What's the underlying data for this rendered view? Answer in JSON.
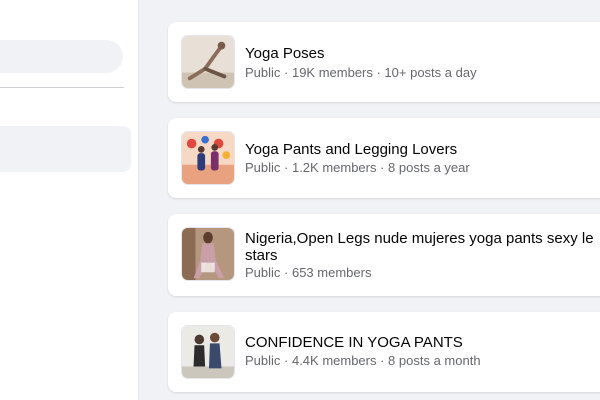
{
  "groups": [
    {
      "name": "Yoga Poses",
      "meta": "Public · 19K members · 10+ posts a day"
    },
    {
      "name": "Yoga Pants and Legging Lovers",
      "meta": "Public · 1.2K members · 8 posts a year"
    },
    {
      "name_line1": "Nigeria,Open Legs nude mujeres yoga pants sexy le",
      "name_line2": "stars",
      "meta": "Public · 653 members"
    },
    {
      "name": "CONFIDENCE IN YOGA PANTS",
      "meta": "Public · 4.4K members · 8 posts a month"
    }
  ]
}
